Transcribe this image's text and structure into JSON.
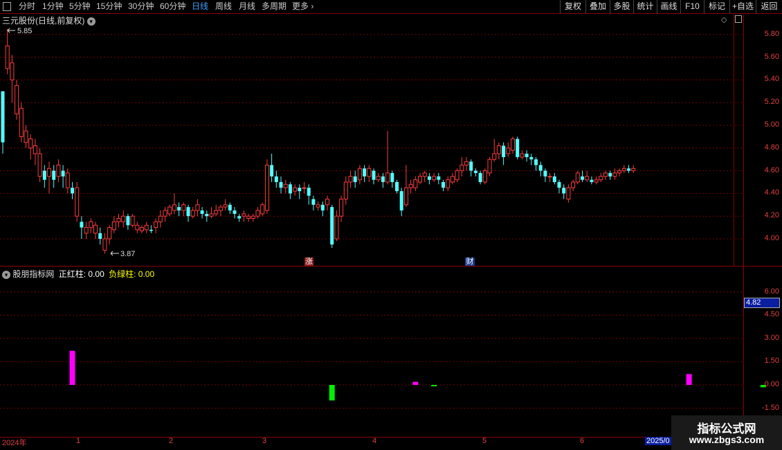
{
  "toolbar": {
    "periods": [
      "分时",
      "1分钟",
      "5分钟",
      "15分钟",
      "30分钟",
      "60分钟",
      "日线",
      "周线",
      "月线",
      "多周期",
      "更多"
    ],
    "active_period": "日线",
    "right_buttons": [
      "复权",
      "叠加",
      "多股",
      "统计",
      "画线",
      "F10",
      "标记",
      "+自选",
      "返回"
    ]
  },
  "main_chart": {
    "title": "三元股份(日线,前复权)",
    "high_label": "5.85",
    "low_label": "3.87",
    "price_ticks": [
      "5.80",
      "5.60",
      "5.40",
      "5.20",
      "5.00",
      "4.80",
      "4.60",
      "4.40",
      "4.20",
      "4.00"
    ],
    "markers": [
      "涨",
      "财"
    ]
  },
  "indicator": {
    "title": "股朋指标网",
    "pos_label": "正红柱:",
    "pos_value": "0.00",
    "neg_label": "负绿柱:",
    "neg_value": "0.00",
    "ticks": [
      "6.00",
      "4.50",
      "3.00",
      "1.50",
      "0.00",
      "-1.50"
    ],
    "cursor_value": "4.82"
  },
  "x_axis": {
    "labels": [
      "2024年",
      "1",
      "2",
      "3",
      "4",
      "5",
      "6",
      "2025/0"
    ]
  },
  "watermark": {
    "line1": "指标公式网",
    "line2": "www.zbgs3.com"
  },
  "chart_data": {
    "type": "candlestick",
    "candles": [
      [
        5.3,
        4.85,
        5.3,
        4.75
      ],
      [
        5.5,
        5.7,
        5.85,
        5.45
      ],
      [
        5.4,
        5.55,
        5.62,
        5.2
      ],
      [
        5.1,
        5.35,
        5.4,
        5.05
      ],
      [
        4.9,
        5.15,
        5.2,
        4.85
      ],
      [
        4.85,
        4.95,
        5.0,
        4.8
      ],
      [
        4.8,
        4.88,
        4.92,
        4.7
      ],
      [
        4.75,
        4.82,
        4.88,
        4.65
      ],
      [
        4.55,
        4.75,
        4.8,
        4.5
      ],
      [
        4.6,
        4.52,
        4.65,
        4.45
      ],
      [
        4.55,
        4.62,
        4.68,
        4.4
      ],
      [
        4.6,
        4.52,
        4.65,
        4.45
      ],
      [
        4.55,
        4.65,
        4.7,
        4.5
      ],
      [
        4.6,
        4.55,
        4.65,
        4.45
      ],
      [
        4.45,
        4.58,
        4.62,
        4.4
      ],
      [
        4.45,
        4.4,
        4.5,
        4.35
      ],
      [
        4.2,
        4.45,
        4.5,
        4.15
      ],
      [
        4.15,
        4.1,
        4.2,
        4.0
      ],
      [
        4.05,
        4.1,
        4.15,
        4.0
      ],
      [
        4.1,
        4.15,
        4.18,
        4.05
      ],
      [
        4.05,
        4.12,
        4.15,
        4.0
      ],
      [
        4.05,
        4.0,
        4.1,
        3.95
      ],
      [
        3.9,
        4.0,
        4.05,
        3.87
      ],
      [
        4.0,
        4.1,
        4.12,
        3.95
      ],
      [
        4.08,
        4.15,
        4.2,
        4.05
      ],
      [
        4.15,
        4.18,
        4.22,
        4.1
      ],
      [
        4.15,
        4.2,
        4.25,
        4.1
      ],
      [
        4.2,
        4.12,
        4.22,
        4.08
      ],
      [
        4.12,
        4.2,
        4.22,
        4.1
      ],
      [
        4.08,
        4.12,
        4.15,
        4.05
      ],
      [
        4.07,
        4.1,
        4.12,
        4.05
      ],
      [
        4.08,
        4.12,
        4.15,
        4.05
      ],
      [
        4.08,
        4.07,
        4.12,
        4.05
      ],
      [
        4.1,
        4.15,
        4.18,
        4.05
      ],
      [
        4.15,
        4.2,
        4.25,
        4.1
      ],
      [
        4.2,
        4.25,
        4.28,
        4.15
      ],
      [
        4.22,
        4.28,
        4.3,
        4.2
      ],
      [
        4.25,
        4.3,
        4.4,
        4.22
      ],
      [
        4.28,
        4.25,
        4.32,
        4.2
      ],
      [
        4.25,
        4.3,
        4.32,
        4.2
      ],
      [
        4.28,
        4.2,
        4.3,
        4.15
      ],
      [
        4.2,
        4.25,
        4.28,
        4.18
      ],
      [
        4.25,
        4.3,
        4.35,
        4.2
      ],
      [
        4.25,
        4.22,
        4.28,
        4.18
      ],
      [
        4.22,
        4.2,
        4.25,
        4.15
      ],
      [
        4.2,
        4.22,
        4.28,
        4.18
      ],
      [
        4.22,
        4.25,
        4.3,
        4.2
      ],
      [
        4.25,
        4.28,
        4.3,
        4.2
      ],
      [
        4.28,
        4.3,
        4.35,
        4.25
      ],
      [
        4.3,
        4.25,
        4.32,
        4.22
      ],
      [
        4.25,
        4.22,
        4.28,
        4.18
      ],
      [
        4.2,
        4.18,
        4.22,
        4.15
      ],
      [
        4.2,
        4.22,
        4.25,
        4.15
      ],
      [
        4.18,
        4.2,
        4.22,
        4.15
      ],
      [
        4.18,
        4.2,
        4.22,
        4.15
      ],
      [
        4.2,
        4.25,
        4.28,
        4.18
      ],
      [
        4.22,
        4.3,
        4.32,
        4.2
      ],
      [
        4.25,
        4.65,
        4.7,
        4.22
      ],
      [
        4.65,
        4.55,
        4.75,
        4.5
      ],
      [
        4.55,
        4.5,
        4.6,
        4.45
      ],
      [
        4.5,
        4.45,
        4.55,
        4.4
      ],
      [
        4.45,
        4.48,
        4.52,
        4.4
      ],
      [
        4.48,
        4.4,
        4.5,
        4.35
      ],
      [
        4.42,
        4.45,
        4.48,
        4.38
      ],
      [
        4.45,
        4.42,
        4.48,
        4.35
      ],
      [
        4.45,
        4.45,
        4.5,
        4.4
      ],
      [
        4.45,
        4.38,
        4.48,
        4.3
      ],
      [
        4.35,
        4.3,
        4.38,
        4.25
      ],
      [
        4.28,
        4.3,
        4.33,
        4.25
      ],
      [
        4.3,
        4.25,
        4.33,
        4.2
      ],
      [
        4.3,
        4.35,
        4.38,
        4.25
      ],
      [
        4.28,
        3.95,
        4.3,
        3.92
      ],
      [
        4.0,
        4.2,
        4.25,
        3.98
      ],
      [
        4.2,
        4.35,
        4.38,
        4.15
      ],
      [
        4.35,
        4.5,
        4.55,
        4.3
      ],
      [
        4.5,
        4.55,
        4.6,
        4.45
      ],
      [
        4.55,
        4.5,
        4.6,
        4.45
      ],
      [
        4.52,
        4.62,
        4.65,
        4.48
      ],
      [
        4.62,
        4.55,
        4.65,
        4.5
      ],
      [
        4.55,
        4.62,
        4.65,
        4.5
      ],
      [
        4.6,
        4.52,
        4.62,
        4.48
      ],
      [
        4.52,
        4.55,
        4.58,
        4.5
      ],
      [
        4.55,
        4.5,
        4.58,
        4.45
      ],
      [
        4.5,
        4.58,
        4.95,
        4.48
      ],
      [
        4.58,
        4.5,
        4.6,
        4.45
      ],
      [
        4.5,
        4.42,
        4.52,
        4.4
      ],
      [
        4.42,
        4.25,
        4.45,
        4.2
      ],
      [
        4.3,
        4.45,
        4.65,
        4.28
      ],
      [
        4.45,
        4.48,
        4.52,
        4.4
      ],
      [
        4.45,
        4.52,
        4.55,
        4.42
      ],
      [
        4.5,
        4.55,
        4.58,
        4.48
      ],
      [
        4.55,
        4.58,
        4.6,
        4.5
      ],
      [
        4.55,
        4.52,
        4.58,
        4.48
      ],
      [
        4.52,
        4.55,
        4.58,
        4.5
      ],
      [
        4.55,
        4.52,
        4.58,
        4.48
      ],
      [
        4.5,
        4.45,
        4.52,
        4.42
      ],
      [
        4.45,
        4.52,
        4.55,
        4.42
      ],
      [
        4.5,
        4.55,
        4.58,
        4.48
      ],
      [
        4.52,
        4.6,
        4.62,
        4.5
      ],
      [
        4.6,
        4.65,
        4.72,
        4.55
      ],
      [
        4.65,
        4.68,
        4.72,
        4.6
      ],
      [
        4.68,
        4.6,
        4.7,
        4.55
      ],
      [
        4.6,
        4.58,
        4.62,
        4.55
      ],
      [
        4.58,
        4.5,
        4.6,
        4.48
      ],
      [
        4.5,
        4.6,
        4.62,
        4.48
      ],
      [
        4.58,
        4.7,
        4.72,
        4.55
      ],
      [
        4.7,
        4.75,
        4.88,
        4.68
      ],
      [
        4.75,
        4.82,
        4.85,
        4.7
      ],
      [
        4.82,
        4.72,
        4.85,
        4.65
      ],
      [
        4.75,
        4.8,
        4.85,
        4.72
      ],
      [
        4.78,
        4.88,
        4.9,
        4.75
      ],
      [
        4.88,
        4.72,
        4.9,
        4.7
      ],
      [
        4.72,
        4.75,
        4.78,
        4.7
      ],
      [
        4.75,
        4.72,
        4.78,
        4.68
      ],
      [
        4.72,
        4.7,
        4.75,
        4.65
      ],
      [
        4.7,
        4.65,
        4.72,
        4.6
      ],
      [
        4.65,
        4.6,
        4.68,
        4.55
      ],
      [
        4.6,
        4.55,
        4.62,
        4.5
      ],
      [
        4.55,
        4.55,
        4.58,
        4.5
      ],
      [
        4.55,
        4.5,
        4.58,
        4.48
      ],
      [
        4.5,
        4.45,
        4.52,
        4.4
      ],
      [
        4.45,
        4.4,
        4.48,
        4.35
      ],
      [
        4.35,
        4.45,
        4.48,
        4.32
      ],
      [
        4.45,
        4.5,
        4.52,
        4.42
      ],
      [
        4.5,
        4.58,
        4.6,
        4.48
      ],
      [
        4.55,
        4.52,
        4.6,
        4.5
      ],
      [
        4.52,
        4.55,
        4.6,
        4.5
      ],
      [
        4.52,
        4.5,
        4.55,
        4.48
      ],
      [
        4.5,
        4.52,
        4.55,
        4.48
      ],
      [
        4.52,
        4.55,
        4.58,
        4.5
      ],
      [
        4.55,
        4.58,
        4.6,
        4.52
      ],
      [
        4.58,
        4.55,
        4.6,
        4.52
      ],
      [
        4.55,
        4.58,
        4.62,
        4.52
      ],
      [
        4.58,
        4.6,
        4.62,
        4.55
      ],
      [
        4.6,
        4.62,
        4.65,
        4.58
      ],
      [
        4.62,
        4.6,
        4.65,
        4.58
      ],
      [
        4.6,
        4.62,
        4.65,
        4.58
      ]
    ],
    "indicator_bars": [
      {
        "index": 15,
        "value": 2.2,
        "color": "#ff00ff"
      },
      {
        "index": 71,
        "value": -1.0,
        "color": "#00ee00"
      },
      {
        "index": 89,
        "value": 0.2,
        "color": "#ff00ff"
      },
      {
        "index": 93,
        "value": -0.05,
        "color": "#00ee00"
      },
      {
        "index": 148,
        "value": 0.7,
        "color": "#ff00ff"
      },
      {
        "index": 164,
        "value": -0.15,
        "color": "#00ee00"
      }
    ]
  }
}
